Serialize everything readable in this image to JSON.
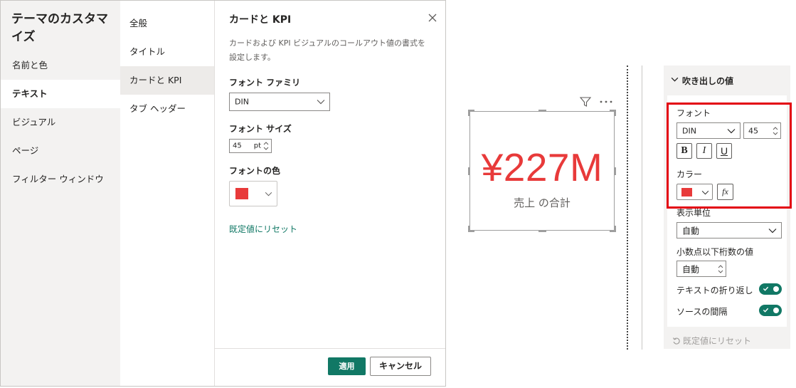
{
  "dialog": {
    "title": "テーマのカスタマイズ",
    "left_nav": [
      {
        "label": "名前と色",
        "active": false
      },
      {
        "label": "テキスト",
        "active": true
      },
      {
        "label": "ビジュアル",
        "active": false
      },
      {
        "label": "ページ",
        "active": false
      },
      {
        "label": "フィルター ウィンドウ",
        "active": false
      }
    ],
    "sub_nav": [
      {
        "label": "全般",
        "active": false
      },
      {
        "label": "タイトル",
        "active": false
      },
      {
        "label": "カードと KPI",
        "active": true
      },
      {
        "label": "タブ ヘッダー",
        "active": false
      }
    ],
    "content": {
      "title": "カードと KPI",
      "description": "カードおよび KPI ビジュアルのコールアウト値の書式を設定します。",
      "font_family_label": "フォント ファミリ",
      "font_family_value": "DIN",
      "font_size_label": "フォント サイズ",
      "font_size_value": "45",
      "font_size_unit": "pt",
      "font_color_label": "フォントの色",
      "font_color": "#e83a3a",
      "reset_label": "既定値にリセット"
    },
    "footer": {
      "apply_label": "適用",
      "cancel_label": "キャンセル"
    }
  },
  "card": {
    "value": "¥227M",
    "label": "売上 の合計",
    "value_color": "#e83a3a"
  },
  "format_pane": {
    "section_title": "吹き出しの値",
    "font_label": "フォント",
    "font_family": "DIN",
    "font_size": "45",
    "bold": "B",
    "italic": "I",
    "underline": "U",
    "color_label": "カラー",
    "fx_label": "fx",
    "display_units_label": "表示単位",
    "display_units_value": "自動",
    "decimal_places_label": "小数点以下桁数の値",
    "decimal_places_value": "自動",
    "text_wrap_label": "テキストの折り返し",
    "source_spacing_label": "ソースの間隔",
    "reset_label": "既定値にリセット"
  },
  "colors": {
    "accent": "#117865",
    "highlight_box": "#e3000f",
    "callout_red": "#e83a3a"
  }
}
